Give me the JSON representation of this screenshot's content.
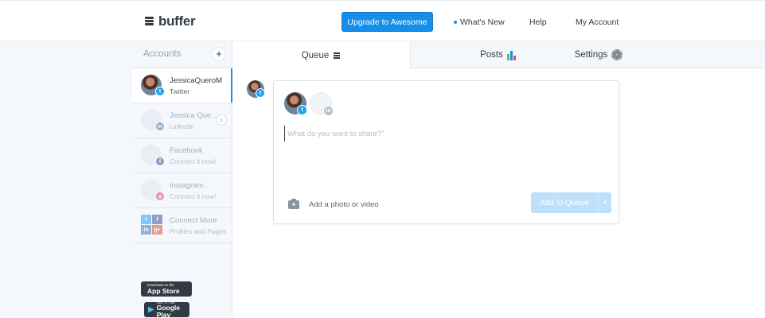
{
  "header": {
    "logo_text": "buffer",
    "upgrade_label": "Upgrade to Awesome",
    "whats_new_label": "What's New",
    "help_label": "Help",
    "my_account_label": "My Account"
  },
  "sidebar": {
    "heading": "Accounts",
    "add_symbol": "+",
    "accounts": [
      {
        "name": "JessicaQueroM",
        "sub": "Twitter",
        "network_icon": "twitter-icon",
        "active": true
      },
      {
        "name": "Jessica Que...",
        "sub": "Linkedin",
        "network_icon": "linkedin-icon",
        "count": "0"
      },
      {
        "name": "Facebook",
        "sub": "Connect it now!",
        "network_icon": "facebook-icon"
      },
      {
        "name": "Instagram",
        "sub": "Connect it now!",
        "network_icon": "instagram-icon"
      },
      {
        "name": "Connect More",
        "sub": "Profiles and Pages",
        "network_icon": "multi-network-icon"
      }
    ],
    "app_store": {
      "small": "Download on the",
      "big": "App Store"
    },
    "google_play": {
      "small": "GET IT ON",
      "big": "Google Play"
    }
  },
  "tabs": {
    "queue": "Queue",
    "posts": "Posts",
    "settings": "Settings"
  },
  "composer": {
    "placeholder": "What do you want to share?\"",
    "add_media_label": "Add a photo or video",
    "add_to_queue_label": "Add to Queue",
    "caret": "▾"
  },
  "colors": {
    "accent": "#168eea",
    "twitter": "#1da1f2",
    "linkedin": "#3a7bb8",
    "facebook": "#3b5998",
    "instagram": "#e1306c",
    "disabled_button": "#bfe0fb"
  }
}
